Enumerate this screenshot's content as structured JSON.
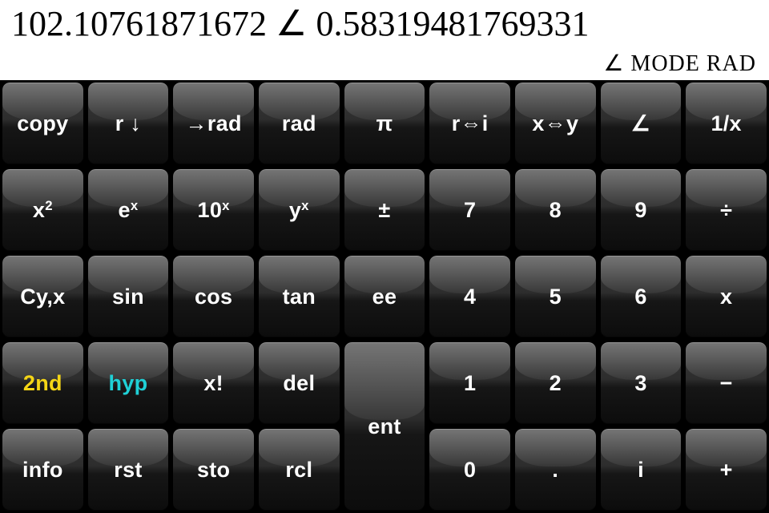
{
  "display": {
    "value": "102.10761871672 ∠ 0.58319481769331",
    "mode": "∠ MODE  RAD"
  },
  "rows": {
    "r1": {
      "copy": "copy",
      "rdown": "r ↓",
      "torad": "→rad",
      "rad": "rad",
      "pi": "π",
      "ri": "r⇔i",
      "xy": "x⇔y",
      "angle": "∠",
      "recip": "1/x"
    },
    "r2": {
      "xsq_base": "x",
      "xsq_exp": "2",
      "ex_base": "e",
      "ex_exp": "x",
      "tenx_base": "10",
      "tenx_exp": "x",
      "ypx_base": "y",
      "ypx_exp": "x",
      "pm": "±",
      "n7": "7",
      "n8": "8",
      "n9": "9",
      "div": "÷"
    },
    "r3": {
      "cyx": "Cy,x",
      "sin": "sin",
      "cos": "cos",
      "tan": "tan",
      "ee": "ee",
      "n4": "4",
      "n5": "5",
      "n6": "6",
      "mul": "x"
    },
    "r4": {
      "second": "2nd",
      "hyp": "hyp",
      "fact": "x!",
      "del": "del",
      "ent": "ent",
      "n1": "1",
      "n2": "2",
      "n3": "3",
      "sub": "−"
    },
    "r5": {
      "info": "info",
      "rst": "rst",
      "sto": "sto",
      "rcl": "rcl",
      "n0": "0",
      "dot": ".",
      "i": "i",
      "add": "+"
    }
  }
}
